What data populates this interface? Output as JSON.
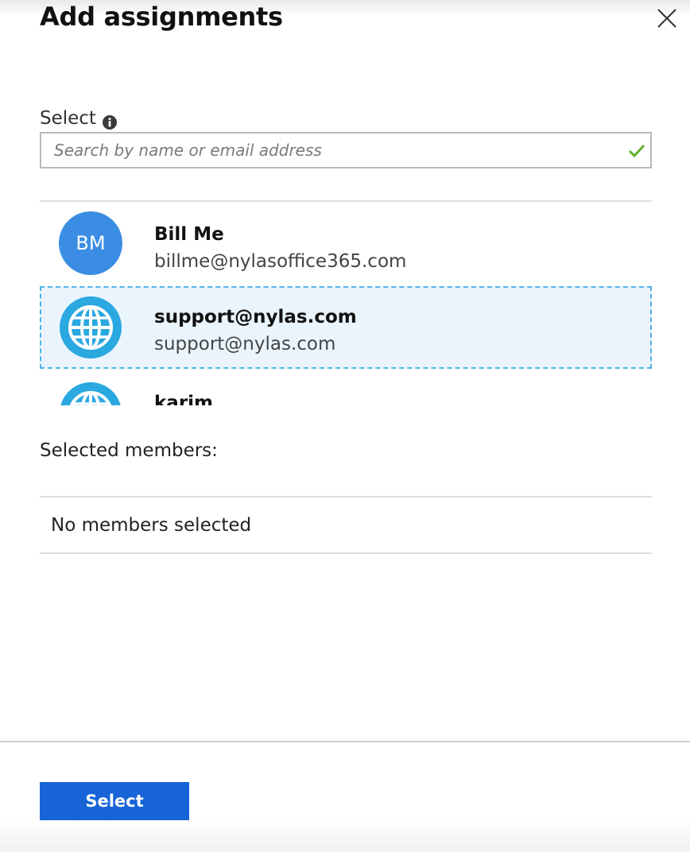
{
  "panel": {
    "title": "Add assignments",
    "close_icon": "close-icon"
  },
  "select": {
    "label": "Select",
    "info_icon": "info-icon",
    "search_placeholder": "Search by name or email address",
    "search_value": "",
    "valid_icon": "checkmark-icon"
  },
  "results": [
    {
      "name": "Bill Me",
      "email": "billme@nylasoffice365.com",
      "avatar_initials": "BM",
      "avatar_type": "initials",
      "highlighted": false
    },
    {
      "name": "support@nylas.com",
      "email": "support@nylas.com",
      "avatar_initials": "",
      "avatar_type": "globe-icon",
      "highlighted": true
    },
    {
      "name": "karim",
      "email": "",
      "avatar_initials": "",
      "avatar_type": "globe-icon",
      "highlighted": false
    }
  ],
  "selected_members": {
    "label": "Selected members:",
    "empty_text": "No members selected"
  },
  "footer": {
    "select_button": "Select"
  },
  "colors": {
    "accent": "#1664d8",
    "avatar_blue": "#3b8de3",
    "globe_blue": "#2aa8e0",
    "highlight_bg": "#eaf4fd",
    "highlight_border": "#4fb3e8",
    "check_green": "#5fb02c"
  }
}
